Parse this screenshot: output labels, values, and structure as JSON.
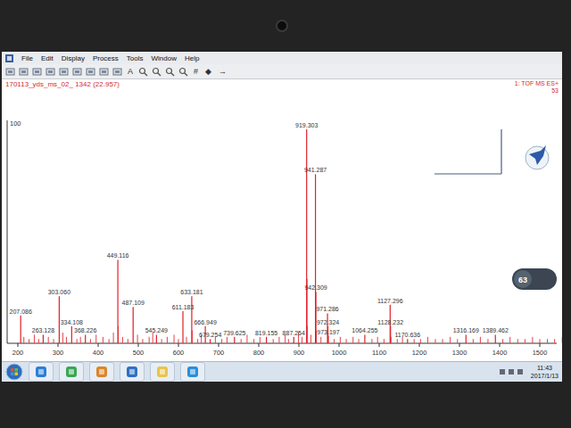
{
  "window": {
    "menu": [
      "File",
      "Edit",
      "Display",
      "Process",
      "Tools",
      "Window",
      "Help"
    ]
  },
  "toolbar": [
    {
      "kind": "icon"
    },
    {
      "kind": "icon"
    },
    {
      "kind": "icon"
    },
    {
      "kind": "icon"
    },
    {
      "kind": "icon"
    },
    {
      "kind": "icon"
    },
    {
      "kind": "icon"
    },
    {
      "kind": "icon"
    },
    {
      "kind": "icon"
    },
    {
      "kind": "glyph",
      "text": "A"
    },
    {
      "kind": "zoom"
    },
    {
      "kind": "zoom"
    },
    {
      "kind": "zoom"
    },
    {
      "kind": "zoom"
    },
    {
      "kind": "glyph",
      "text": "#"
    },
    {
      "kind": "glyph",
      "text": "◆"
    },
    {
      "kind": "glyph",
      "text": "→"
    }
  ],
  "spectrum": {
    "title": "170113_yds_ms_02_ 1342 (22.957)",
    "mode": "1: TOF MS ES+",
    "mode_value": "53",
    "y_axis": {
      "max_label": "100"
    },
    "x_axis": {
      "ticks": [
        "200",
        "300",
        "400",
        "500",
        "600",
        "700",
        "800",
        "900",
        "1000",
        "1100",
        "1200",
        "1300",
        "1400",
        "1500"
      ]
    },
    "peaks": [
      {
        "label": "207.086",
        "mz": 207.086,
        "intensity": 13
      },
      {
        "label": "263.128",
        "mz": 263.128,
        "intensity": 4
      },
      {
        "label": "303.060",
        "mz": 303.06,
        "intensity": 22
      },
      {
        "label": "334.108",
        "mz": 334.108,
        "intensity": 8
      },
      {
        "label": "368.226",
        "mz": 368.226,
        "intensity": 4
      },
      {
        "label": "449.116",
        "mz": 449.116,
        "intensity": 39
      },
      {
        "label": "487.109",
        "mz": 487.109,
        "intensity": 17
      },
      {
        "label": "545.249",
        "mz": 545.249,
        "intensity": 4
      },
      {
        "label": "611.183",
        "mz": 611.183,
        "intensity": 15
      },
      {
        "label": "633.181",
        "mz": 633.181,
        "intensity": 22
      },
      {
        "label": "666.949",
        "mz": 666.949,
        "intensity": 8
      },
      {
        "label": "679.254",
        "mz": 679.254,
        "intensity": 2
      },
      {
        "label": "739.625",
        "mz": 739.625,
        "intensity": 3
      },
      {
        "label": "819.155",
        "mz": 819.155,
        "intensity": 3
      },
      {
        "label": "887.254",
        "mz": 887.254,
        "intensity": 3
      },
      {
        "label": "919.303",
        "mz": 919.303,
        "intensity": 100
      },
      {
        "label": "941.287",
        "mz": 941.287,
        "intensity": 79
      },
      {
        "label": "942.309",
        "mz": 942.309,
        "intensity": 24
      },
      {
        "label": "971.286",
        "mz": 971.286,
        "intensity": 14
      },
      {
        "label": "972.324",
        "mz": 972.324,
        "intensity": 8
      },
      {
        "label": "973.197",
        "mz": 973.197,
        "intensity": 3.5
      },
      {
        "label": "1064.255",
        "mz": 1064.255,
        "intensity": 4
      },
      {
        "label": "1127.296",
        "mz": 1127.296,
        "intensity": 18
      },
      {
        "label": "1128.232",
        "mz": 1128.232,
        "intensity": 8
      },
      {
        "label": "1170.636",
        "mz": 1170.636,
        "intensity": 2
      },
      {
        "label": "1316.169",
        "mz": 1316.169,
        "intensity": 4
      },
      {
        "label": "1389.462",
        "mz": 1389.462,
        "intensity": 4
      }
    ],
    "minor_peaks": {
      "mz": [
        215,
        228,
        241,
        252,
        276,
        289,
        312,
        321,
        347,
        356,
        381,
        395,
        412,
        427,
        438,
        450.1,
        461,
        474,
        498,
        511,
        527,
        536,
        558,
        572,
        589,
        600,
        620,
        634.2,
        648,
        657,
        692,
        708,
        721,
        756,
        771,
        788,
        803,
        836,
        851,
        866,
        874,
        899,
        908,
        920.3,
        921.3,
        930,
        943.3,
        955,
        988,
        1003,
        1018,
        1035,
        1049,
        1082,
        1096,
        1112,
        1129.2,
        1145,
        1158,
        1187,
        1203,
        1221,
        1240,
        1258,
        1277,
        1295,
        1334,
        1352,
        1371,
        1408,
        1426,
        1445,
        1463,
        1482,
        1500,
        1519,
        1537,
        1556,
        1572
      ],
      "intensity": [
        3,
        2,
        4,
        2,
        3,
        2,
        5,
        3,
        2,
        3,
        2,
        4,
        3,
        2,
        5,
        8,
        3,
        2,
        4,
        2,
        3,
        5,
        2,
        3,
        4,
        2,
        3,
        6,
        2,
        4,
        3,
        2,
        3,
        2,
        4,
        2,
        3,
        2,
        3,
        4,
        2,
        5,
        3,
        30,
        8,
        4,
        6,
        3,
        2,
        3,
        2,
        3,
        2,
        2,
        3,
        2,
        3,
        2,
        3,
        2,
        2,
        3,
        2,
        2,
        3,
        2,
        2,
        3,
        2,
        2,
        3,
        2,
        2,
        3,
        2,
        2,
        2,
        3,
        2
      ]
    }
  },
  "overlay_badge": {
    "value": "63"
  },
  "taskbar": {
    "apps": [
      {
        "color": "#2a7fd4"
      },
      {
        "color": "#3aa655"
      },
      {
        "color": "#d9862a"
      },
      {
        "color": "#2f6fc2"
      },
      {
        "color": "#e8c44a"
      },
      {
        "color": "#2a8fd8"
      }
    ],
    "clock": {
      "time": "11:43",
      "date": "2017/1/13"
    }
  }
}
